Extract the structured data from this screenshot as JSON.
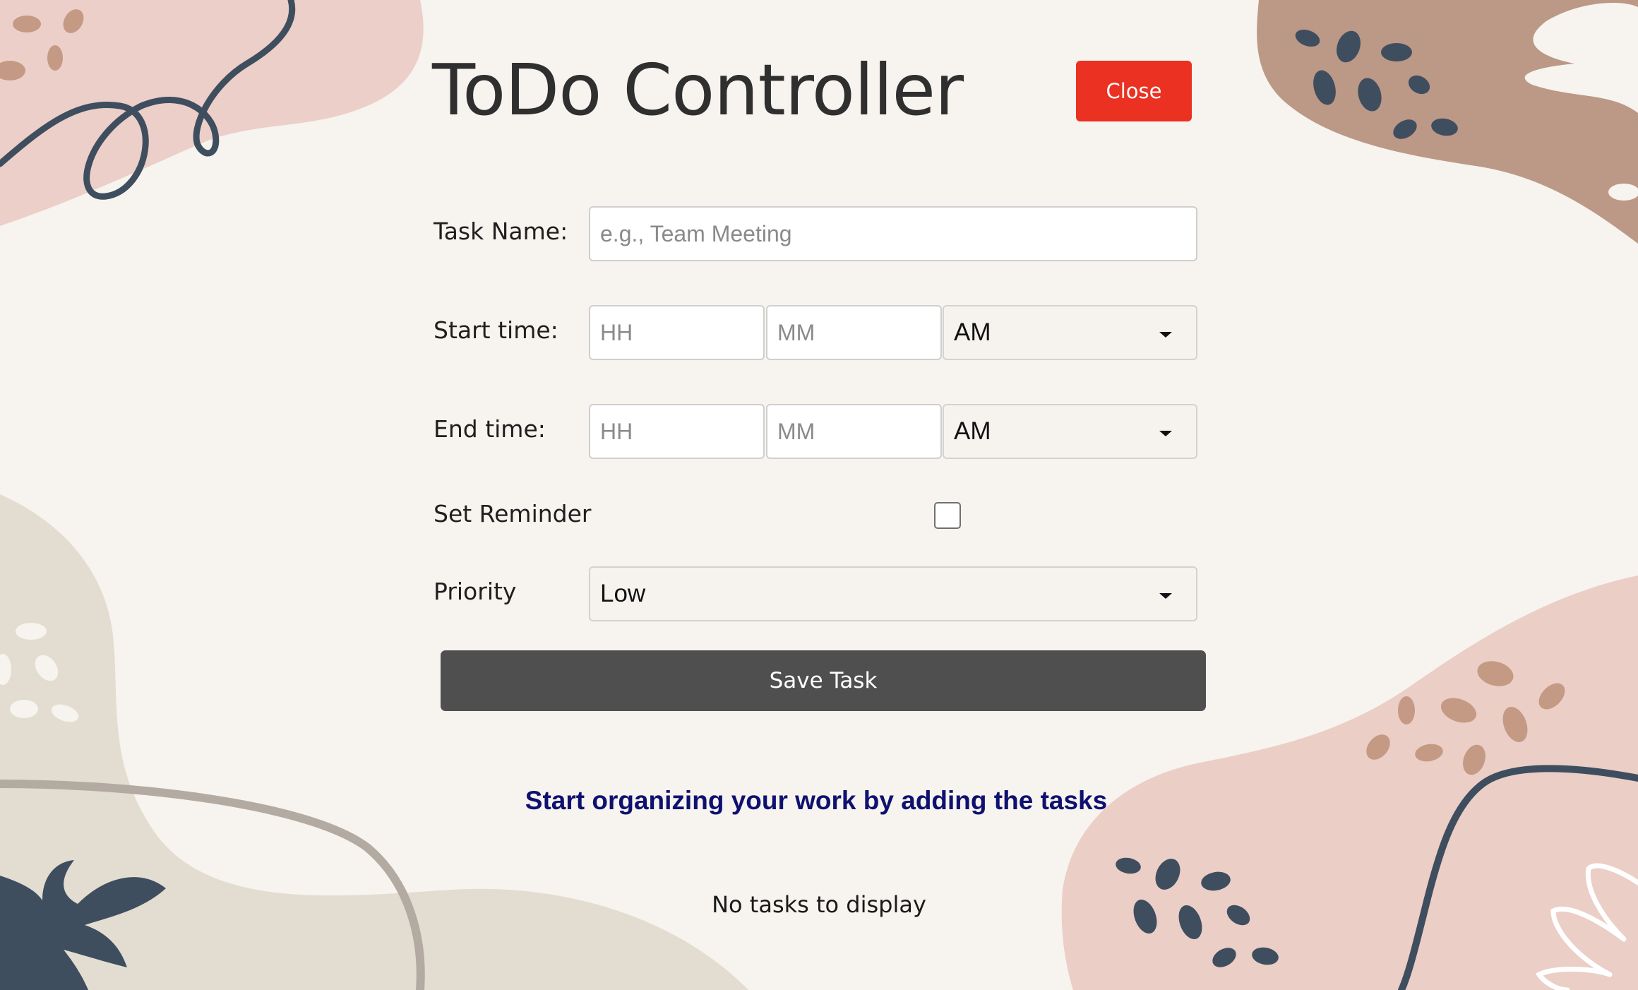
{
  "header": {
    "title": "ToDo Controller",
    "close_label": "Close"
  },
  "form": {
    "task_name": {
      "label": "Task Name:",
      "placeholder": "e.g., Team Meeting",
      "value": ""
    },
    "start_time": {
      "label": "Start time:",
      "hour_placeholder": "HH",
      "minute_placeholder": "MM",
      "period": "AM"
    },
    "end_time": {
      "label": "End time:",
      "hour_placeholder": "HH",
      "minute_placeholder": "MM",
      "period": "AM"
    },
    "reminder": {
      "label": "Set Reminder",
      "checked": false
    },
    "priority": {
      "label": "Priority",
      "value": "Low"
    },
    "save_label": "Save Task"
  },
  "messages": {
    "hint": "Start organizing your work by adding the tasks",
    "empty": "No tasks to display"
  },
  "colors": {
    "background": "#f7f3ee",
    "close_button": "#ea3122",
    "save_button": "#4f4f4f",
    "hint_text": "#0e1170"
  }
}
